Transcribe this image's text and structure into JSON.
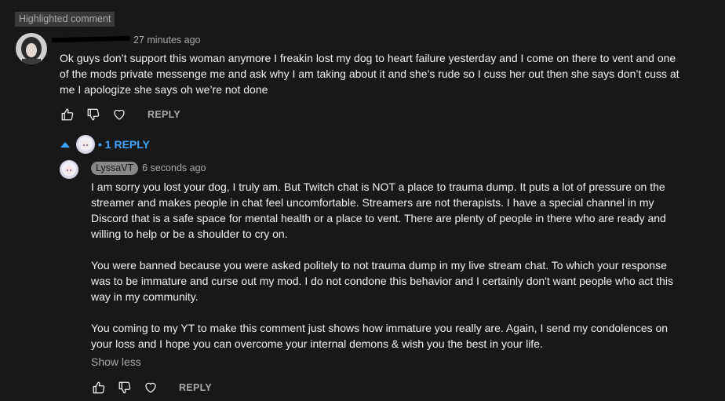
{
  "highlight_label": "Highlighted comment",
  "comment": {
    "timestamp": "27 minutes ago",
    "text": "Ok guys don’t support this woman anymore I freakin lost my dog to heart failure yesterday and I come on there to vent and one of the mods private messenge me and ask why I am taking about it and she’s rude so I cuss her out then she says don’t cuss at me I apologize she says oh we’re not done",
    "reply_label": "REPLY"
  },
  "replies_toggle": {
    "label": "• 1 REPLY"
  },
  "reply": {
    "author": "LyssaVT",
    "timestamp": "6 seconds ago",
    "paragraphs": [
      "I am sorry you lost your dog, I truly am. But Twitch chat is NOT a place to trauma dump. It puts a lot of pressure on the streamer and makes people in chat feel uncomfortable. Streamers are not therapists. I have a special channel in my Discord that is a safe space for mental health or a place to vent. There are plenty of people in there who are ready and willing to help or be a shoulder to cry on.",
      "You were banned because you were asked politely to not trauma dump in my live stream chat. To which your response was to be immature and curse out my mod. I do not condone this behavior and I certainly don't want people who act this way in my community.",
      "You coming to my YT to make this comment just shows how immature you really are. Again, I send my condolences on your loss and I hope you can overcome your internal demons & wish you the best in  your life."
    ],
    "show_less": "Show less",
    "reply_label": "REPLY"
  },
  "icons": {
    "like": "thumbs-up-icon",
    "dislike": "thumbs-down-icon",
    "heart": "heart-icon",
    "collapse": "caret-up-icon"
  }
}
